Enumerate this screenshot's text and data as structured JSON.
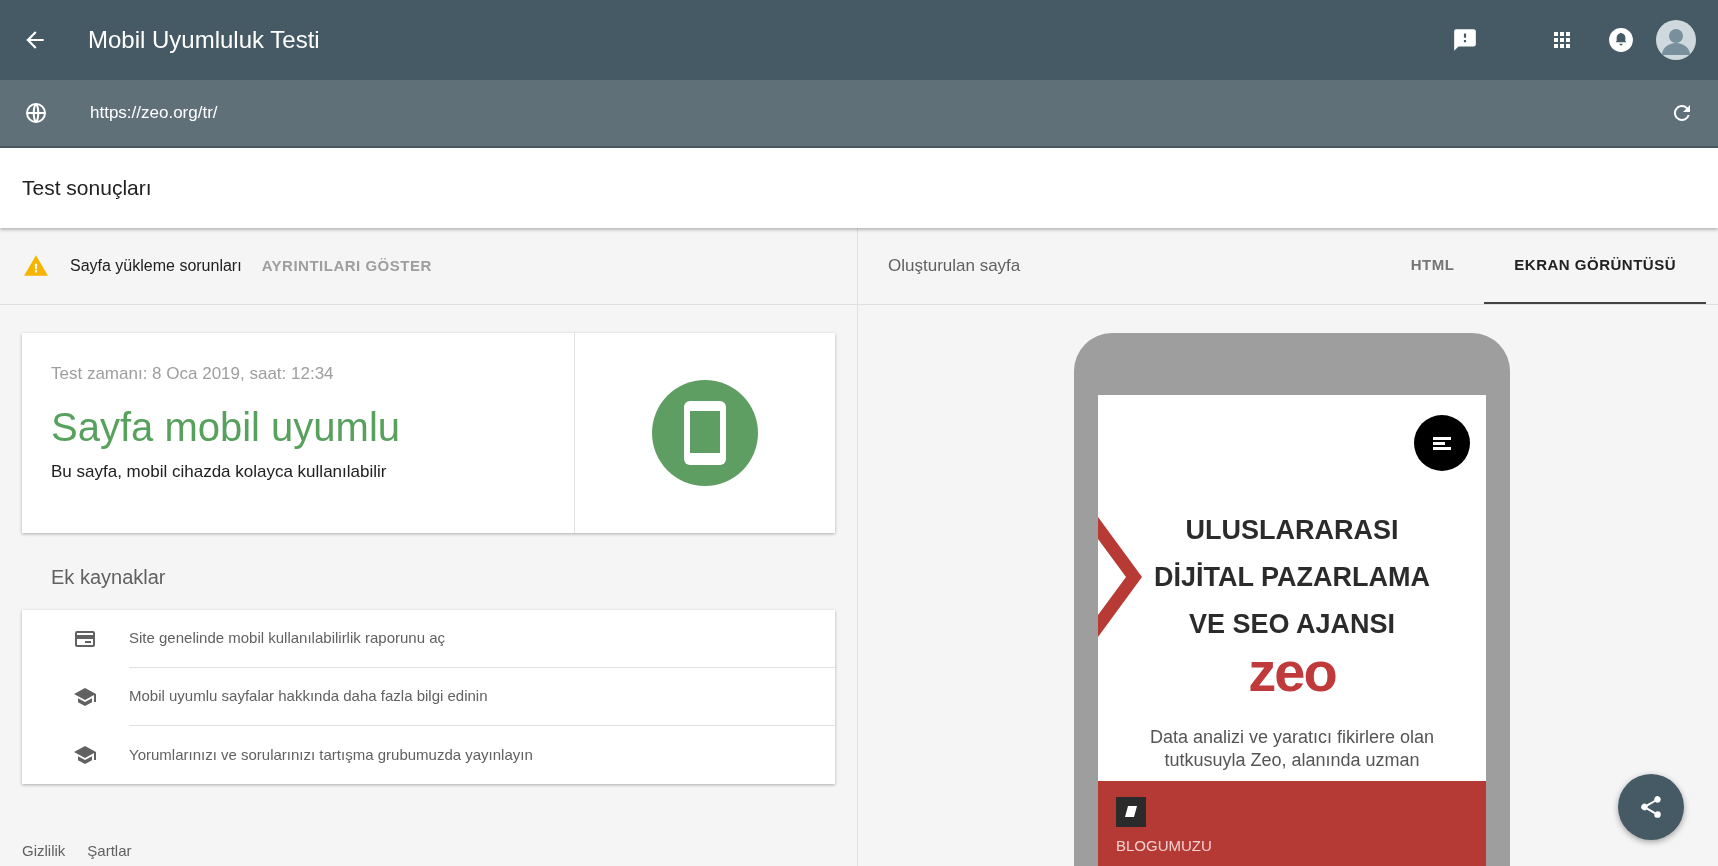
{
  "app_bar": {
    "title": "Mobil Uyumluluk Testi"
  },
  "url_bar": {
    "value": "https://zeo.org/tr/"
  },
  "section_title": "Test sonuçları",
  "issues": {
    "label": "Sayfa yükleme sorunları",
    "action": "AYRINTILARI GÖSTER"
  },
  "result": {
    "time": "Test zamanı: 8 Oca 2019, saat: 12:34",
    "headline": "Sayfa mobil uyumlu",
    "description": "Bu sayfa, mobil cihazda kolayca kullanılabilir"
  },
  "resources": {
    "title": "Ek kaynaklar",
    "items": [
      {
        "kind": "report",
        "label": "Site genelinde mobil kullanılabilirlik raporunu aç"
      },
      {
        "kind": "learn",
        "label": "Mobil uyumlu sayfalar hakkında daha fazla bilgi edinin"
      },
      {
        "kind": "learn",
        "label": "Yorumlarınızı ve sorularınızı tartışma grubumuzda yayınlayın"
      }
    ]
  },
  "footer": [
    "Gizlilik",
    "Şartlar"
  ],
  "preview": {
    "title": "Oluşturulan sayfa",
    "tabs": [
      {
        "label": "HTML",
        "selected": false
      },
      {
        "label": "EKRAN GÖRÜNTÜSÜ",
        "selected": true
      }
    ],
    "screenshot": {
      "heading": [
        "ULUSLARARASI",
        "DİJİTAL PAZARLAMA",
        "VE SEO AJANSI"
      ],
      "logo": "zeo",
      "text": "Data analizi ve yaratıcı fikirlere olan tutkusuyla Zeo, alanında uzman",
      "banner_link": "BLOGUMUZU"
    }
  }
}
